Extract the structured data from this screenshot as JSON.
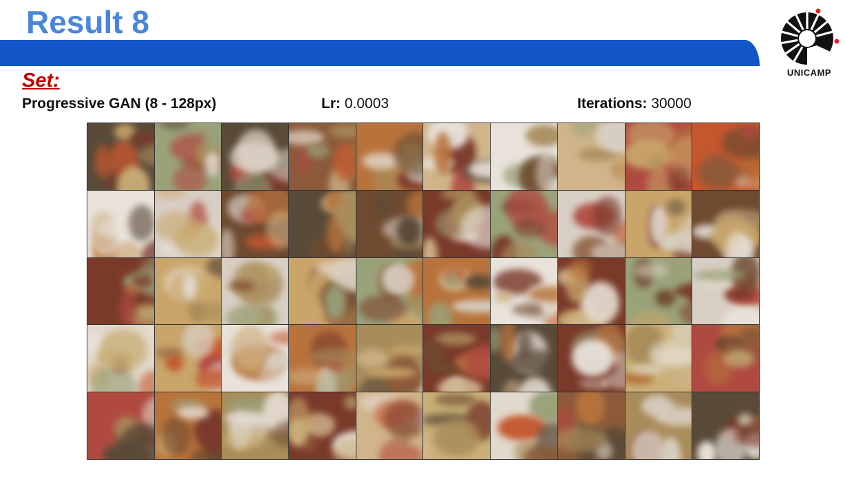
{
  "slide": {
    "title": "Result 8",
    "set_label": "Set:",
    "model": "Progressive GAN (8 - 128px)",
    "lr_label": "Lr:",
    "lr_value": "0.0003",
    "iterations_label": "Iterations:",
    "iterations_value": "30000"
  },
  "logo": {
    "text": "UNICAMP"
  },
  "colors": {
    "title": "#4a86d9",
    "bar": "#1256c8",
    "set_label": "#c00000"
  },
  "grid": {
    "rows": 5,
    "cols": 10
  }
}
